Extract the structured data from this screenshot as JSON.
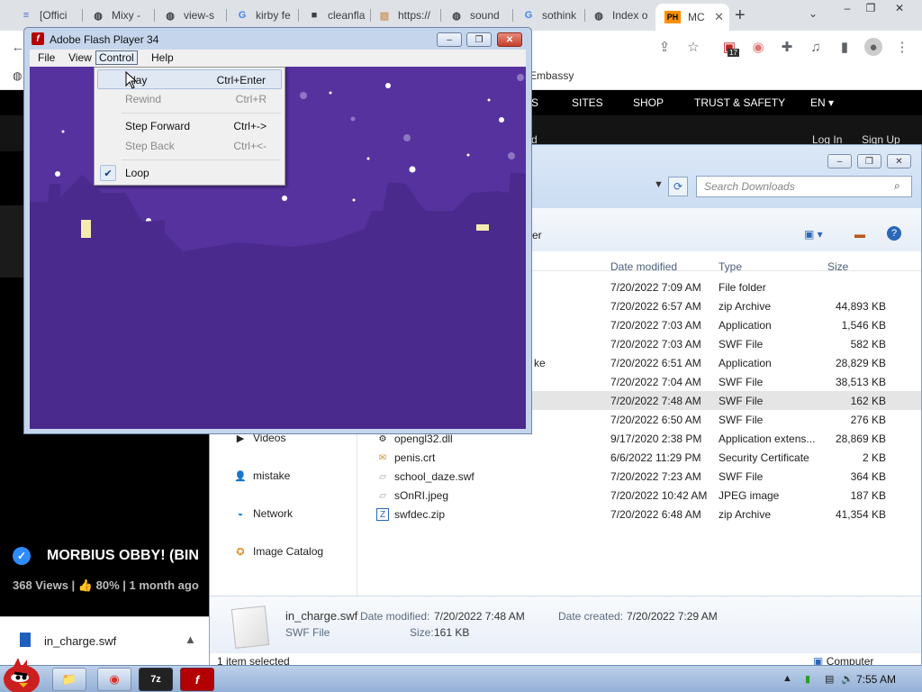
{
  "browser": {
    "tabs": [
      {
        "label": "[Offici",
        "favicon": "list-icon"
      },
      {
        "label": "Mixy -",
        "favicon": "globe-icon"
      },
      {
        "label": "view-s",
        "favicon": "globe-icon"
      },
      {
        "label": "kirby fe",
        "favicon": "google-icon"
      },
      {
        "label": "cleanfla",
        "favicon": "square-icon"
      },
      {
        "label": "https://",
        "favicon": "image-icon"
      },
      {
        "label": "sound",
        "favicon": "globe-icon"
      },
      {
        "label": "sothink",
        "favicon": "google-icon"
      },
      {
        "label": "Index o",
        "favicon": "globe-icon"
      },
      {
        "label": "MC",
        "favicon": "ph-icon",
        "badge": "PH"
      }
    ],
    "new_tab": "+",
    "extension_badge": "17",
    "bookmark_fragment": "Embassy",
    "window_min": "–",
    "window_max": "❐",
    "window_close": "✕"
  },
  "site": {
    "nav": [
      "S",
      "SITES",
      "SHOP",
      "TRUST & SAFETY",
      "EN ▾"
    ],
    "subnav_fragment": "d",
    "login": "Log In",
    "signup": "Sign Up",
    "video_title": "MORBIUS OBBY! (BIN",
    "video_views": "368 Views",
    "video_rating": "80%",
    "video_age": "1 month ago",
    "verified_icon": "✓"
  },
  "download_bar": {
    "filename": "in_charge.swf",
    "arrow": "▲"
  },
  "flash": {
    "title": "Adobe Flash Player 34",
    "menu": [
      "File",
      "View",
      "Control",
      "Help"
    ],
    "control_menu": [
      {
        "label": "Play",
        "shortcut": "Ctrl+Enter",
        "enabled": true,
        "hover": true
      },
      {
        "label": "Rewind",
        "shortcut": "Ctrl+R",
        "enabled": false
      },
      {
        "label": "Step Forward",
        "shortcut": "Ctrl+->",
        "enabled": true
      },
      {
        "label": "Step Back",
        "shortcut": "Ctrl+<-",
        "enabled": false
      },
      {
        "label": "Loop",
        "shortcut": "",
        "enabled": true,
        "checked": true
      }
    ],
    "stage_bg": "#56329e",
    "hill_color": "#4a2a8c"
  },
  "explorer": {
    "search_placeholder": "Search Downloads",
    "cmd_fragment": "er",
    "columns": [
      "Date modified",
      "Type",
      "Size"
    ],
    "nav": [
      {
        "label": "Videos",
        "icon": "video-folder-icon"
      },
      {
        "label": "mistake",
        "icon": "user-icon"
      },
      {
        "label": "Network",
        "icon": "network-icon"
      },
      {
        "label": "Image Catalog",
        "icon": "catalog-icon"
      }
    ],
    "rows": [
      {
        "name": "",
        "date": "7/20/2022 7:09 AM",
        "type": "File folder",
        "size": ""
      },
      {
        "name": "",
        "date": "7/20/2022 6:57 AM",
        "type": "zip Archive",
        "size": "44,893 KB"
      },
      {
        "name": "",
        "date": "7/20/2022 7:03 AM",
        "type": "Application",
        "size": "1,546 KB"
      },
      {
        "name": "",
        "date": "7/20/2022 7:03 AM",
        "type": "SWF File",
        "size": "582 KB"
      },
      {
        "name": "",
        "date": "7/20/2022 6:51 AM",
        "type": "Application",
        "size": "28,829 KB",
        "fragment": "ke"
      },
      {
        "name": "",
        "date": "7/20/2022 7:04 AM",
        "type": "SWF File",
        "size": "38,513 KB"
      },
      {
        "name": "",
        "date": "7/20/2022 7:48 AM",
        "type": "SWF File",
        "size": "162 KB",
        "selected": true
      },
      {
        "name": "",
        "date": "7/20/2022 6:50 AM",
        "type": "SWF File",
        "size": "276 KB"
      },
      {
        "name": "opengl32.dll",
        "date": "9/17/2020 2:38 PM",
        "type": "Application extens...",
        "size": "28,869 KB",
        "icon": "dll-icon"
      },
      {
        "name": "penis.crt",
        "date": "6/6/2022 11:29 PM",
        "type": "Security Certificate",
        "size": "2 KB",
        "icon": "certificate-icon"
      },
      {
        "name": "school_daze.swf",
        "date": "7/20/2022 7:23 AM",
        "type": "SWF File",
        "size": "364 KB",
        "icon": "swf-file-icon"
      },
      {
        "name": "sOnRI.jpeg",
        "date": "7/20/2022 10:42 AM",
        "type": "JPEG image",
        "size": "187 KB",
        "icon": "image-file-icon"
      },
      {
        "name": "swfdec.zip",
        "date": "7/20/2022 6:48 AM",
        "type": "zip Archive",
        "size": "41,354 KB",
        "icon": "zip-file-icon"
      }
    ],
    "details": {
      "filename": "in_charge.swf",
      "filetype": "SWF File",
      "modified_label": "Date modified:",
      "modified_value": "7/20/2022 7:48 AM",
      "created_label": "Date created:",
      "created_value": "7/20/2022 7:29 AM",
      "size_label": "Size:",
      "size_value": "161 KB"
    },
    "status_left": "1 item selected",
    "status_right": "Computer"
  },
  "taskbar": {
    "clock": "7:55 AM",
    "apps": [
      "explorer-icon",
      "chrome-icon",
      "7zip-icon",
      "flash-icon"
    ],
    "sevenzip_label": "7z"
  }
}
